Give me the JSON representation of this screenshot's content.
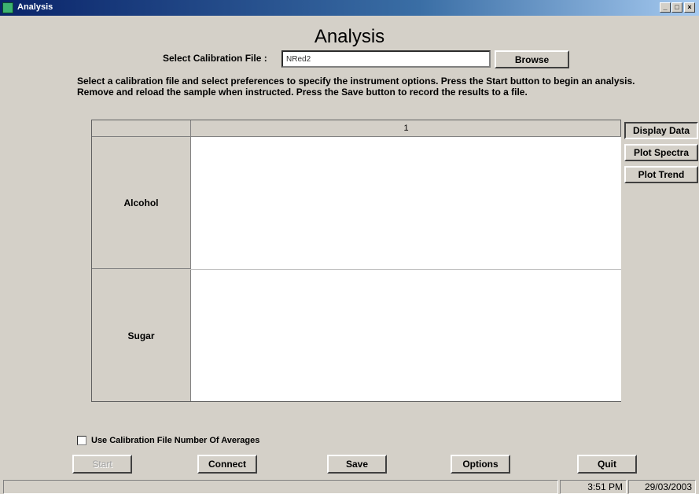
{
  "window": {
    "title": "Analysis",
    "controls": [
      "_",
      "□",
      "×"
    ]
  },
  "page": {
    "heading": "Analysis"
  },
  "calibration": {
    "label": "Select Calibration File :",
    "value": "NRed2",
    "browse_label": "Browse"
  },
  "instructions": "Select a calibration file and select preferences to specify the instrument options. Press the Start button to begin an analysis. Remove and reload the sample when instructed. Press the Save button to record the results to a file.",
  "grid": {
    "column_header": "1",
    "rows": [
      {
        "label": "Alcohol",
        "value": ""
      },
      {
        "label": "Sugar",
        "value": ""
      }
    ]
  },
  "side_buttons": {
    "display_data": "Display Data",
    "plot_spectra": "Plot Spectra",
    "plot_trend": "Plot Trend"
  },
  "options_checkbox": {
    "label": "Use Calibration File Number Of Averages",
    "checked": false
  },
  "buttons": {
    "start": "Start",
    "connect": "Connect",
    "save": "Save",
    "options": "Options",
    "quit": "Quit"
  },
  "status": {
    "time": "3:51 PM",
    "date": "29/03/2003"
  }
}
